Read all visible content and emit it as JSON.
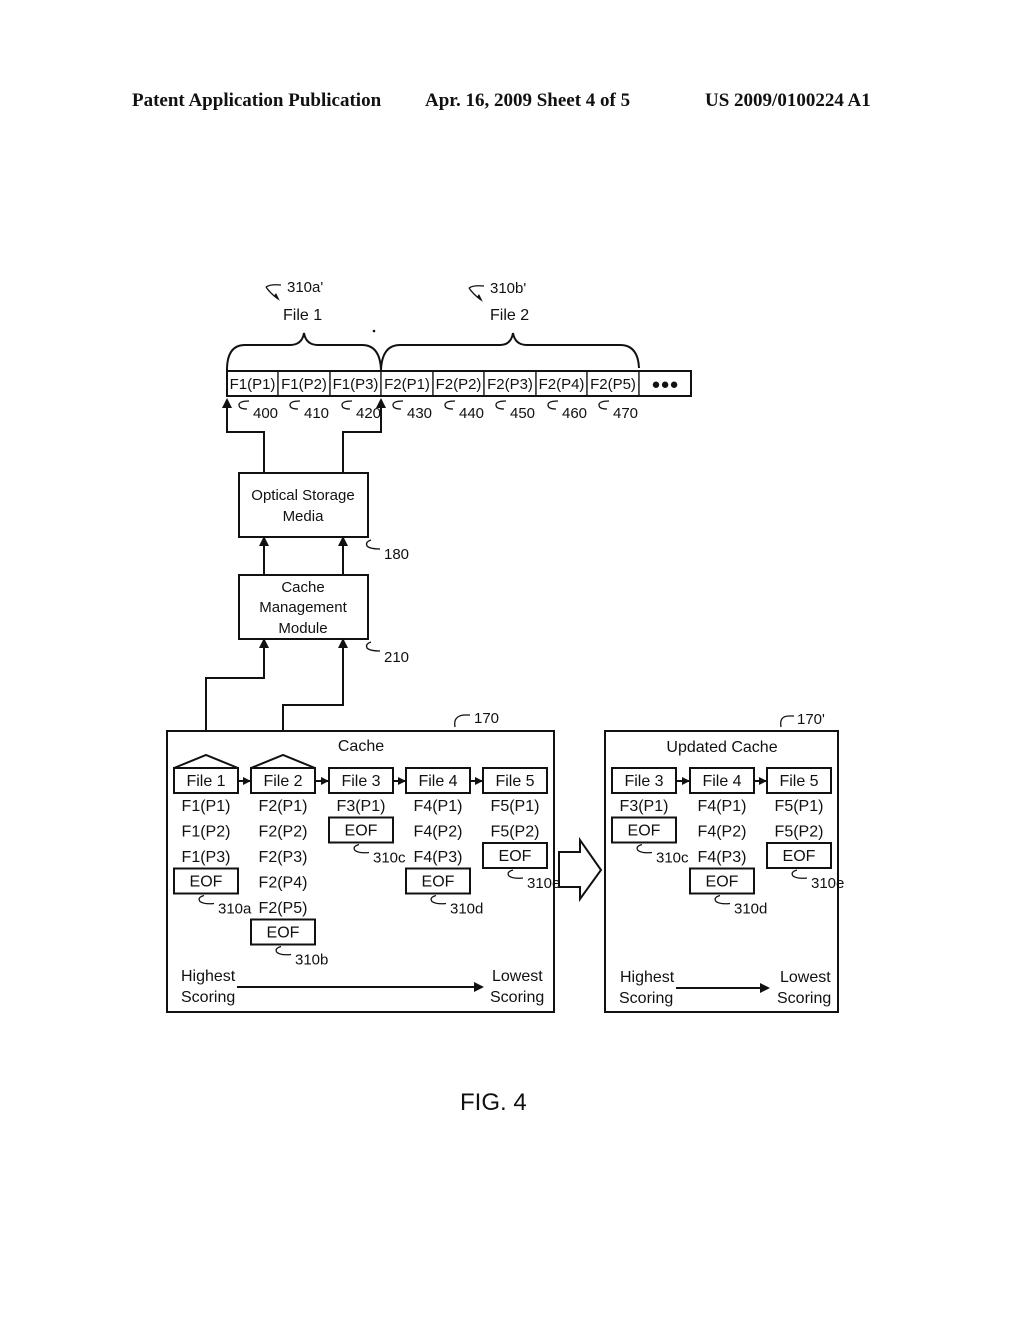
{
  "header": {
    "publication": "Patent Application Publication",
    "date_sheet": "Apr. 16, 2009  Sheet 4 of 5",
    "number": "US 2009/0100224 A1"
  },
  "figure": {
    "label": "FIG. 4",
    "file_groups": [
      {
        "ref": "310a'",
        "label": "File 1"
      },
      {
        "ref": "310b'",
        "label": "File 2"
      }
    ],
    "storage_cells": [
      {
        "label": "F1(P1)",
        "ref": "400"
      },
      {
        "label": "F1(P2)",
        "ref": "410"
      },
      {
        "label": "F1(P3)",
        "ref": "420"
      },
      {
        "label": "F2(P1)",
        "ref": "430"
      },
      {
        "label": "F2(P2)",
        "ref": "440"
      },
      {
        "label": "F2(P3)",
        "ref": "450"
      },
      {
        "label": "F2(P4)",
        "ref": "460"
      },
      {
        "label": "F2(P5)",
        "ref": "470"
      },
      {
        "label": "●●●",
        "ref": ""
      }
    ],
    "optical_storage": {
      "line1": "Optical Storage",
      "line2": "Media",
      "ref": "180"
    },
    "cache_module": {
      "line1": "Cache",
      "line2": "Management",
      "line3": "Module",
      "ref": "210"
    },
    "cache": {
      "title": "Cache",
      "ref": "170",
      "files": [
        {
          "name": "File 1",
          "parts": [
            "F1(P1)",
            "F1(P2)",
            "F1(P3)"
          ],
          "eof": "EOF",
          "eof_ref": "310a"
        },
        {
          "name": "File 2",
          "parts": [
            "F2(P1)",
            "F2(P2)",
            "F2(P3)",
            "F2(P4)",
            "F2(P5)"
          ],
          "eof": "EOF",
          "eof_ref": "310b"
        },
        {
          "name": "File 3",
          "parts": [
            "F3(P1)"
          ],
          "eof": "EOF",
          "eof_ref": "310c"
        },
        {
          "name": "File 4",
          "parts": [
            "F4(P1)",
            "F4(P2)",
            "F4(P3)"
          ],
          "eof": "EOF",
          "eof_ref": "310d"
        },
        {
          "name": "File 5",
          "parts": [
            "F5(P1)",
            "F5(P2)"
          ],
          "eof": "EOF",
          "eof_ref": "310e"
        }
      ],
      "scale_left_1": "Highest",
      "scale_left_2": "Scoring",
      "scale_right_1": "Lowest",
      "scale_right_2": "Scoring"
    },
    "updated_cache": {
      "title": "Updated Cache",
      "ref": "170'",
      "files": [
        {
          "name": "File 3",
          "parts": [
            "F3(P1)"
          ],
          "eof": "EOF",
          "eof_ref": "310c"
        },
        {
          "name": "File 4",
          "parts": [
            "F4(P1)",
            "F4(P2)",
            "F4(P3)"
          ],
          "eof": "EOF",
          "eof_ref": "310d"
        },
        {
          "name": "File 5",
          "parts": [
            "F5(P1)",
            "F5(P2)"
          ],
          "eof": "EOF",
          "eof_ref": "310e"
        }
      ],
      "scale_left_1": "Highest",
      "scale_left_2": "Scoring",
      "scale_right_1": "Lowest",
      "scale_right_2": "Scoring"
    }
  }
}
